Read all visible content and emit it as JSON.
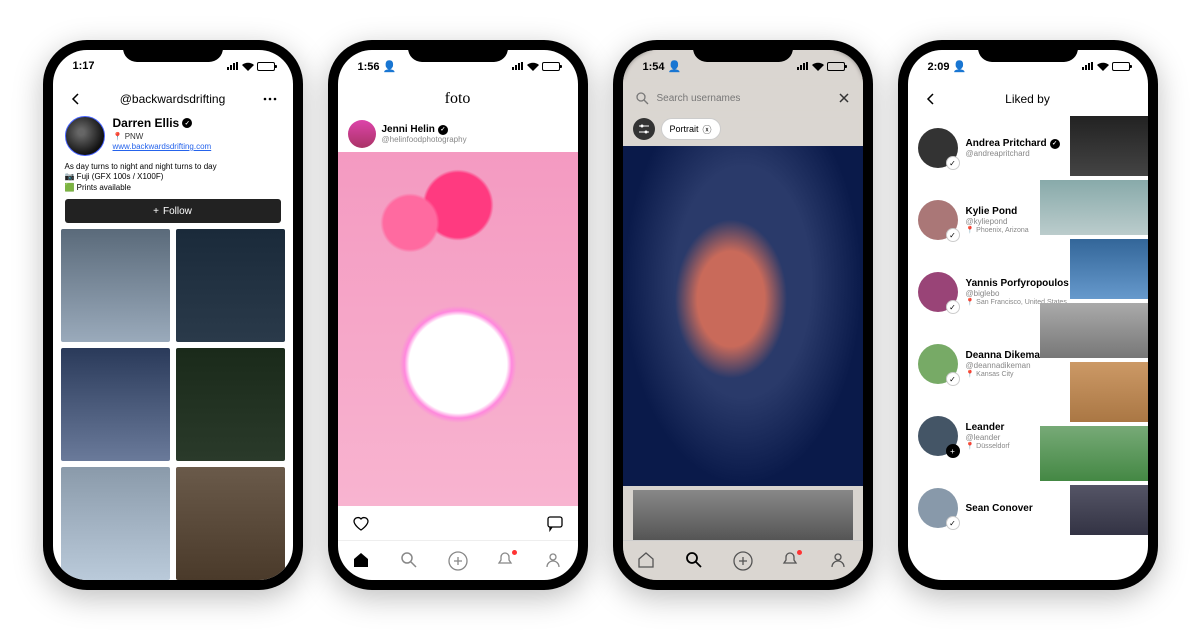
{
  "phone1": {
    "time": "1:17",
    "nav_title": "@backwardsdrifting",
    "display_name": "Darren Ellis",
    "location": "PNW",
    "website": "www.backwardsdrifting.com",
    "bio_line1": "As day turns to night and night turns to day",
    "bio_line2": "📷 Fuji (GFX 100s / X100F)",
    "bio_line3": "🟩 Prints available",
    "follow_label": "Follow"
  },
  "phone2": {
    "time": "1:56",
    "logo": "foto",
    "author_name": "Jenni Helin",
    "author_handle": "@helinfoodphotography"
  },
  "phone3": {
    "time": "1:54",
    "search_placeholder": "Search usernames",
    "chip_label": "Portrait"
  },
  "phone4": {
    "time": "2:09",
    "title": "Liked by",
    "users": [
      {
        "name": "Andrea Pritchard",
        "handle": "@andreapritchard",
        "loc": "",
        "verified": true,
        "plus": false
      },
      {
        "name": "Kylie Pond",
        "handle": "@kyliepond",
        "loc": "Phoenix, Arizona",
        "verified": false,
        "plus": false
      },
      {
        "name": "Yannis Porfyropoulos",
        "handle": "@biglebo",
        "loc": "San Francisco, United States",
        "verified": true,
        "plus": false
      },
      {
        "name": "Deanna Dikeman",
        "handle": "@deannadikeman",
        "loc": "Kansas City",
        "verified": false,
        "plus": false
      },
      {
        "name": "Leander",
        "handle": "@leander",
        "loc": "Düsseldorf",
        "verified": false,
        "plus": true
      },
      {
        "name": "Sean Conover",
        "handle": "",
        "loc": "",
        "verified": false,
        "plus": false
      }
    ]
  }
}
